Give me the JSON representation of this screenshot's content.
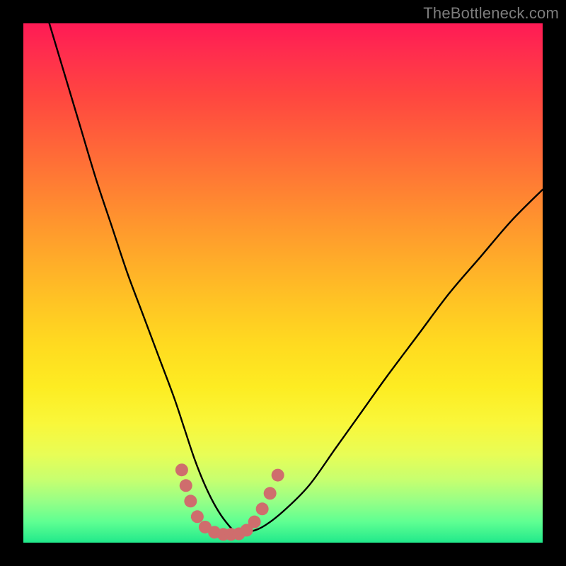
{
  "attribution": "TheBottleneck.com",
  "colors": {
    "page_bg": "#000000",
    "curve_stroke": "#000000",
    "marker_fill": "#cf6d6d",
    "marker_stroke": "#cf6d6d"
  },
  "chart_data": {
    "type": "line",
    "title": "",
    "xlabel": "",
    "ylabel": "",
    "xlim": [
      0,
      100
    ],
    "ylim": [
      0,
      100
    ],
    "grid": false,
    "legend": false,
    "series": [
      {
        "name": "bottleneck-curve",
        "x": [
          5,
          8,
          11,
          14,
          17,
          20,
          23,
          26,
          29,
          31,
          33,
          35,
          37,
          39,
          41,
          43,
          46,
          50,
          55,
          60,
          65,
          70,
          76,
          82,
          88,
          94,
          100
        ],
        "y": [
          100,
          90,
          80,
          70,
          61,
          52,
          44,
          36,
          28,
          22,
          16,
          11,
          7,
          4,
          2,
          2,
          3,
          6,
          11,
          18,
          25,
          32,
          40,
          48,
          55,
          62,
          68
        ]
      }
    ],
    "markers": [
      {
        "x": 30.5,
        "y": 14.0
      },
      {
        "x": 31.3,
        "y": 11.0
      },
      {
        "x": 32.2,
        "y": 8.0
      },
      {
        "x": 33.5,
        "y": 5.0
      },
      {
        "x": 35.0,
        "y": 3.0
      },
      {
        "x": 36.8,
        "y": 2.0
      },
      {
        "x": 38.5,
        "y": 1.6
      },
      {
        "x": 40.0,
        "y": 1.6
      },
      {
        "x": 41.5,
        "y": 1.7
      },
      {
        "x": 43.0,
        "y": 2.4
      },
      {
        "x": 44.5,
        "y": 4.0
      },
      {
        "x": 46.0,
        "y": 6.5
      },
      {
        "x": 47.5,
        "y": 9.5
      },
      {
        "x": 49.0,
        "y": 13.0
      }
    ]
  }
}
